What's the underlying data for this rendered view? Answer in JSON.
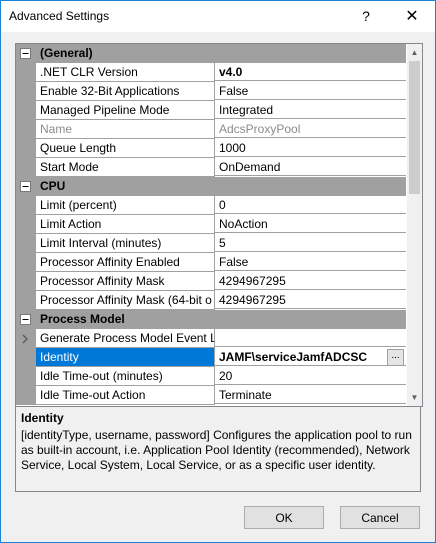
{
  "window": {
    "title": "Advanced Settings",
    "help_glyph": "?",
    "close_glyph": "✕"
  },
  "categories": [
    {
      "label": "(General)",
      "rows": [
        {
          "name": ".NET CLR Version",
          "value": "v4.0",
          "bold": true
        },
        {
          "name": "Enable 32-Bit Applications",
          "value": "False"
        },
        {
          "name": "Managed Pipeline Mode",
          "value": "Integrated"
        },
        {
          "name": "Name",
          "value": "AdcsProxyPool",
          "readonly": true
        },
        {
          "name": "Queue Length",
          "value": "1000"
        },
        {
          "name": "Start Mode",
          "value": "OnDemand"
        }
      ]
    },
    {
      "label": "CPU",
      "rows": [
        {
          "name": "Limit (percent)",
          "value": "0"
        },
        {
          "name": "Limit Action",
          "value": "NoAction"
        },
        {
          "name": "Limit Interval (minutes)",
          "value": "5"
        },
        {
          "name": "Processor Affinity Enabled",
          "value": "False"
        },
        {
          "name": "Processor Affinity Mask",
          "value": "4294967295"
        },
        {
          "name": "Processor Affinity Mask (64-bit o",
          "value": "4294967295"
        }
      ]
    },
    {
      "label": "Process Model",
      "rows": [
        {
          "name": "Generate Process Model Event L",
          "value": "",
          "expandable": true
        },
        {
          "name": "Identity",
          "value": "JAMF\\serviceJamfADCSC",
          "selected": true
        },
        {
          "name": "Idle Time-out (minutes)",
          "value": "20"
        },
        {
          "name": "Idle Time-out Action",
          "value": "Terminate"
        }
      ]
    }
  ],
  "ellipsis_label": "...",
  "description": {
    "title": "Identity",
    "text": "[identityType, username, password] Configures the application pool to run as built-in account, i.e. Application Pool Identity (recommended), Network Service, Local System, Local Service, or as a specific user identity."
  },
  "buttons": {
    "ok": "OK",
    "cancel": "Cancel"
  }
}
